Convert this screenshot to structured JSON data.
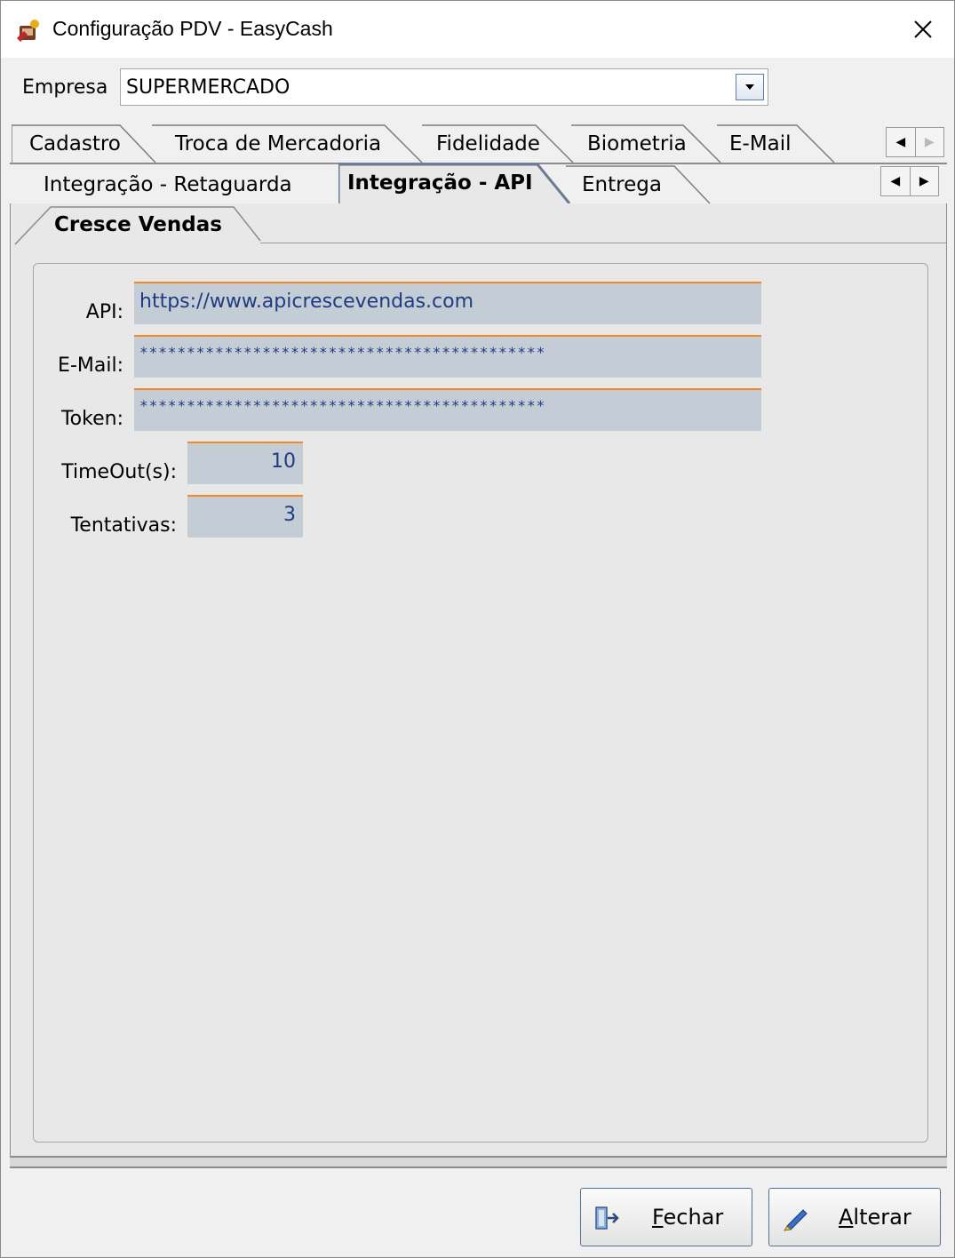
{
  "window": {
    "title": "Configuração PDV - EasyCash",
    "icon": "easycash-app-icon",
    "close_icon": "close-icon"
  },
  "empresa": {
    "label": "Empresa",
    "value": "SUPERMERCADO"
  },
  "tabs_row1": [
    {
      "label": "Cadastro"
    },
    {
      "label": "Troca de Mercadoria"
    },
    {
      "label": "Fidelidade"
    },
    {
      "label": "Biometria"
    },
    {
      "label": "E-Mail"
    }
  ],
  "tabs_row2": [
    {
      "label": "Integração - Retaguarda"
    },
    {
      "label": "Integração - API",
      "active": true
    },
    {
      "label": "Entrega"
    }
  ],
  "subtab": {
    "label": "Cresce Vendas"
  },
  "form": {
    "api_label": "API:",
    "api_value": "https://www.apicrescevendas.com",
    "email_label": "E-Mail:",
    "email_value": "*******************************************",
    "token_label": "Token:",
    "token_value": "*******************************************",
    "timeout_label": "TimeOut(s):",
    "timeout_value": "10",
    "tentativas_label": "Tentativas:",
    "tentativas_value": "3"
  },
  "buttons": {
    "fechar_prefix": "F",
    "fechar_rest": "echar",
    "alterar_prefix": "A",
    "alterar_rest": "lterar"
  },
  "colors": {
    "field_bg": "#c4ccd6",
    "field_accent": "#f28a1e",
    "field_text": "#1f3c80"
  }
}
